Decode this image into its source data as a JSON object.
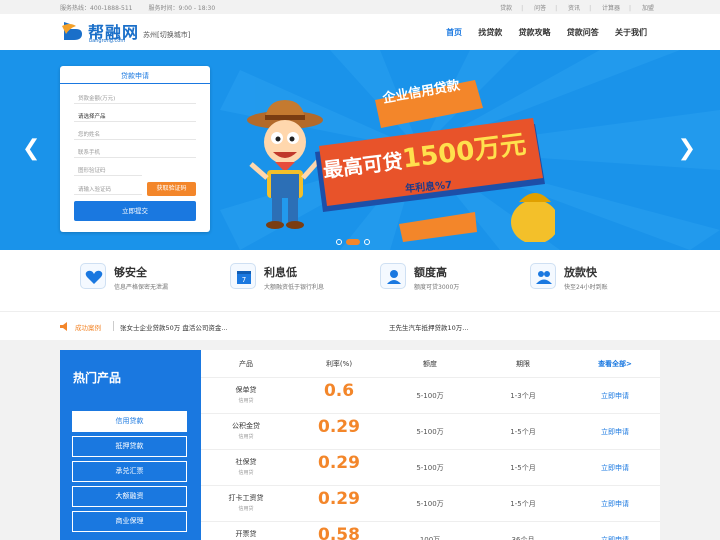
{
  "topbar": {
    "hotline": "服务热线：400-1888-511",
    "hours": "服务时间：9:00 - 18:30",
    "links": [
      "贷款",
      "问答",
      "资讯",
      "计算器",
      "加盟"
    ]
  },
  "header": {
    "logo_text": "帮融网",
    "logo_sub": "bangrong.com",
    "city": "苏州[切换城市]",
    "nav": [
      "首页",
      "找贷款",
      "贷款攻略",
      "贷款问答",
      "关于我们"
    ]
  },
  "banner": {
    "form": {
      "title": "贷款申请",
      "amount_placeholder": "贷款金额(万元)",
      "product_select": "请选择产品",
      "name_placeholder": "您的姓名",
      "phone_placeholder": "联系手机",
      "captcha_placeholder": "图形验证码",
      "sms_placeholder": "请输入验证码",
      "sms_button": "获取验证码",
      "submit": "立即提交"
    },
    "promo": {
      "tag": "企业信用贷款",
      "headline_pre": "最高可贷",
      "headline_amount": "1500万元",
      "rate": "年利息%7"
    },
    "slide_count": 3,
    "active_slide": 2
  },
  "features": [
    {
      "title": "够安全",
      "desc": "信息严格保密无泄漏",
      "icon": "heart-shield-icon"
    },
    {
      "title": "利息低",
      "desc": "大额融资低于银行利息",
      "icon": "calendar-icon"
    },
    {
      "title": "额度高",
      "desc": "额度可贷3000万",
      "icon": "user-icon"
    },
    {
      "title": "放款快",
      "desc": "快至24小时到账",
      "icon": "users-icon"
    }
  ],
  "ticker": {
    "label": "成功案例",
    "items": [
      "张女士企业贷款50万 盘活公司资金...",
      "王先生汽车抵押贷款10万..."
    ]
  },
  "products": {
    "title": "热门产品",
    "categories": [
      "信用贷款",
      "抵押贷款",
      "承兑汇票",
      "大额融资",
      "商业保理"
    ],
    "active_category": 0,
    "columns": [
      "产品",
      "利率(%)",
      "额度",
      "期限",
      "查看全部>"
    ],
    "rows": [
      {
        "name": "保单贷",
        "type": "信用贷",
        "rate": "0.6",
        "amount": "5-100万",
        "term": "1-3个月",
        "action": "立即申请"
      },
      {
        "name": "公积金贷",
        "type": "信用贷",
        "rate": "0.29",
        "amount": "5-100万",
        "term": "1-5个月",
        "action": "立即申请"
      },
      {
        "name": "社保贷",
        "type": "信用贷",
        "rate": "0.29",
        "amount": "5-100万",
        "term": "1-5个月",
        "action": "立即申请"
      },
      {
        "name": "打卡工资贷",
        "type": "信用贷",
        "rate": "0.29",
        "amount": "5-100万",
        "term": "1-5个月",
        "action": "立即申请"
      },
      {
        "name": "开票贷",
        "type": "",
        "rate": "0.58",
        "amount": "100万",
        "term": "36个月",
        "action": "立即申请"
      }
    ]
  },
  "colors": {
    "primary": "#1a78e0",
    "accent": "#f3862a",
    "banner_bg": "#1a93ea"
  }
}
